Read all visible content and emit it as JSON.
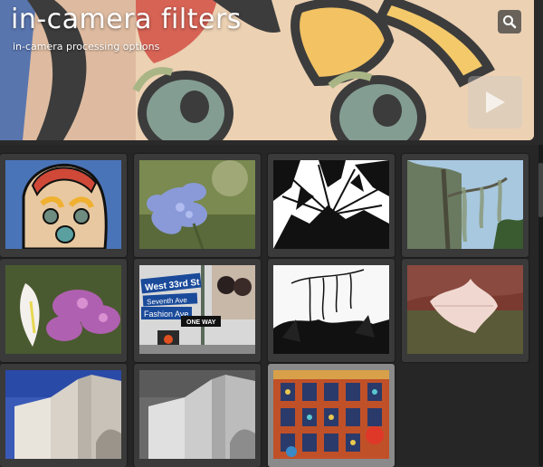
{
  "header": {
    "title": "in-camera filters",
    "subtitle": "in-camera processing options"
  },
  "icons": {
    "search": "search-icon",
    "play": "play-icon"
  },
  "thumbnails": [
    {
      "name": "thumb-toy-clown-poster",
      "subject": "toy clown illustration"
    },
    {
      "name": "thumb-blue-flower",
      "subject": "blue flower"
    },
    {
      "name": "thumb-palm-high-contrast",
      "subject": "palm leaves high contrast"
    },
    {
      "name": "thumb-moss-tree",
      "subject": "tree with spanish moss"
    },
    {
      "name": "thumb-white-lily-purple",
      "subject": "white lily with purple flowers"
    },
    {
      "name": "thumb-street-signs",
      "subject": "street signs"
    },
    {
      "name": "thumb-moss-sketch",
      "subject": "moss tree sketch"
    },
    {
      "name": "thumb-leaf-red-texture",
      "subject": "leaf on red texture"
    },
    {
      "name": "thumb-building-blue-sky",
      "subject": "building with blue sky"
    },
    {
      "name": "thumb-building-mono",
      "subject": "building monochrome"
    },
    {
      "name": "thumb-hdr-facade",
      "subject": "hdr decorated facade",
      "selected": true
    }
  ],
  "street_signs": {
    "sign1": "West 33rd St",
    "sign2": "Seventh Ave",
    "sign3": "Fashion Ave",
    "sign4": "ONE WAY"
  }
}
